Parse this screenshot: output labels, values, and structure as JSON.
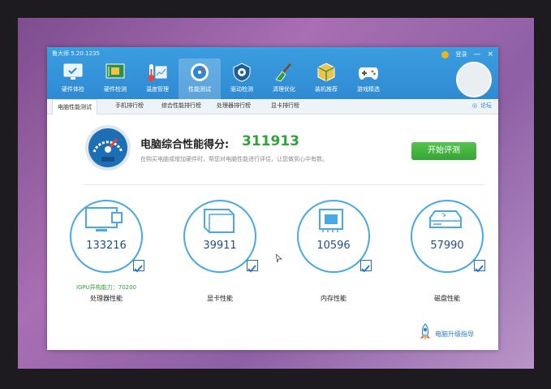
{
  "app": {
    "title": "鲁大师 5.20.1235"
  },
  "titlebar": {
    "login": "登录",
    "minimize": "—",
    "close": "×"
  },
  "toolbar": {
    "items": [
      {
        "label": "硬件体检",
        "icon": "monitor-check-icon"
      },
      {
        "label": "硬件检测",
        "icon": "chip-board-icon"
      },
      {
        "label": "温度管理",
        "icon": "thermometer-chart-icon"
      },
      {
        "label": "性能测试",
        "icon": "speedometer-icon"
      },
      {
        "label": "驱动检测",
        "icon": "gear-shield-icon"
      },
      {
        "label": "清理优化",
        "icon": "broom-icon"
      },
      {
        "label": "装机推荐",
        "icon": "cube-icon"
      },
      {
        "label": "游戏精选",
        "icon": "gamepad-icon"
      }
    ]
  },
  "subtabs": {
    "items": [
      "电脑性能测试",
      "手机排行榜",
      "综合性能排行榜",
      "处理器排行榜",
      "显卡排行榜"
    ],
    "right_label": "论坛"
  },
  "score": {
    "label": "电脑综合性能得分:",
    "value": "311913",
    "description": "在购买电脑或增加硬件时，帮您对电脑性能进行评估，让您做到心中有数。",
    "start_button": "开始评测"
  },
  "metrics": [
    {
      "value": "133216",
      "label": "处理器性能",
      "extra": "IGPU异构能力：70200",
      "icon": "cpu-monitor-icon"
    },
    {
      "value": "39911",
      "label": "显卡性能",
      "extra": "",
      "icon": "graphics-card-icon"
    },
    {
      "value": "10596",
      "label": "内存性能",
      "extra": "",
      "icon": "memory-chip-icon"
    },
    {
      "value": "57990",
      "label": "磁盘性能",
      "extra": "",
      "icon": "hard-disk-icon"
    }
  ],
  "upgrade": {
    "label": "电脑升级指导"
  },
  "colors": {
    "accent": "#2f8ad2",
    "score_green": "#2ea43b",
    "ring_blue": "#48a9e3",
    "button_green": "#34a533"
  }
}
